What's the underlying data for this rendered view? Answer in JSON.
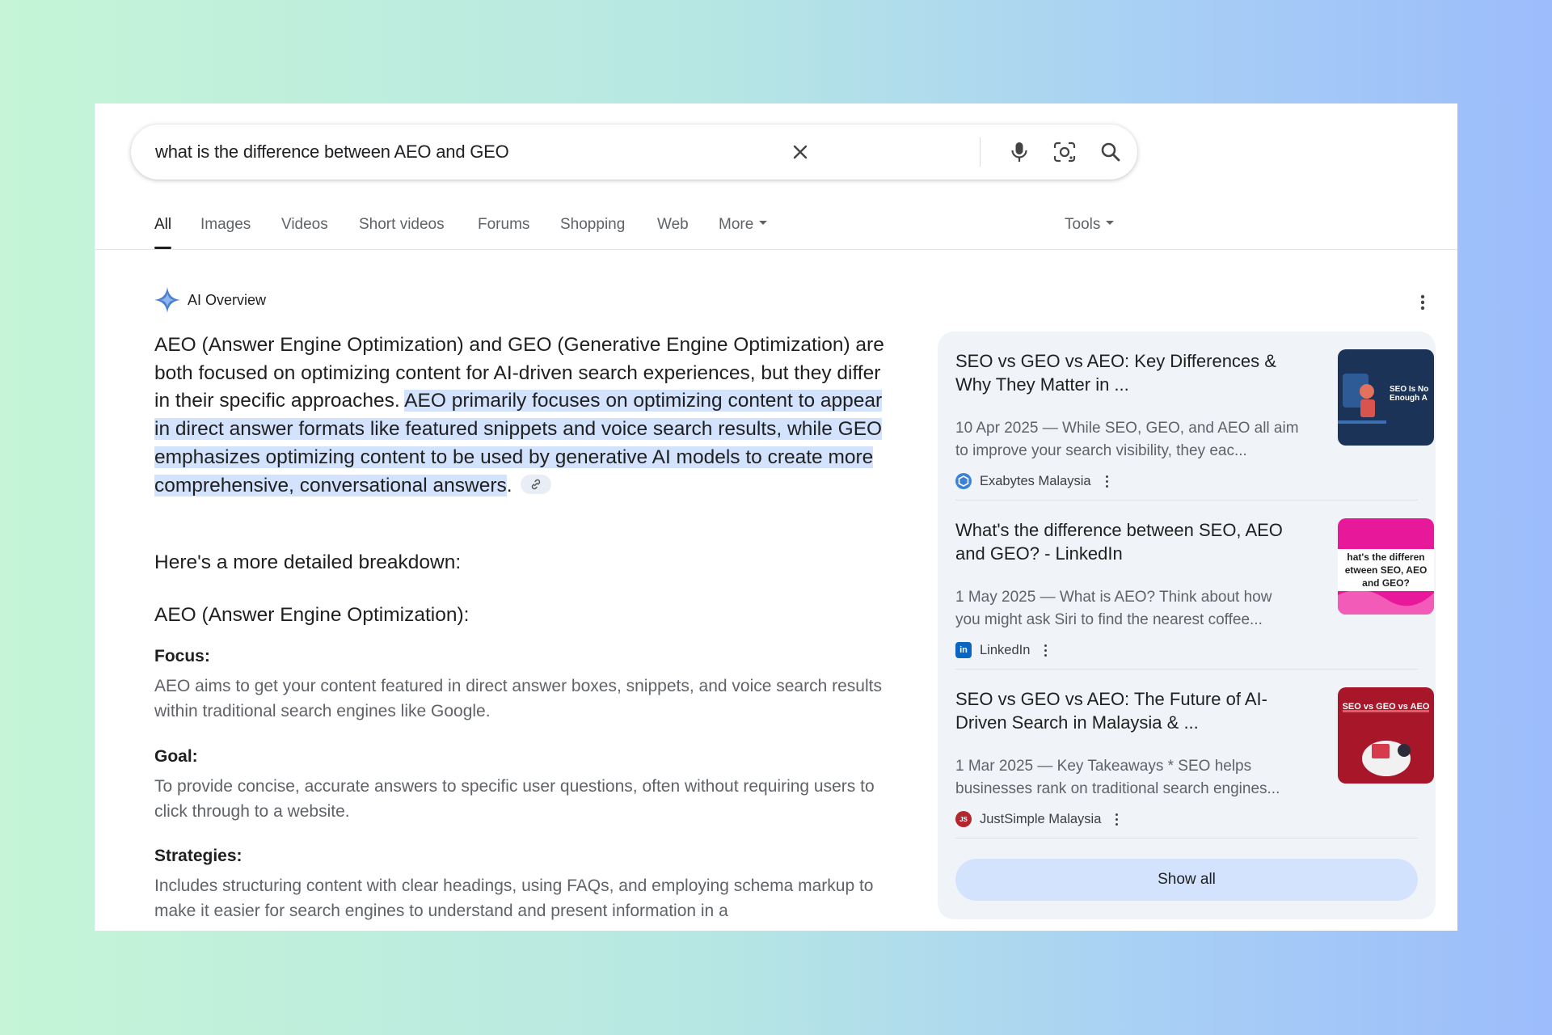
{
  "search": {
    "query": "what is the difference between AEO and GEO"
  },
  "tabs": [
    {
      "label": "All"
    },
    {
      "label": "Images"
    },
    {
      "label": "Videos"
    },
    {
      "label": "Short videos"
    },
    {
      "label": "Forums"
    },
    {
      "label": "Shopping"
    },
    {
      "label": "Web"
    },
    {
      "label": "More"
    }
  ],
  "tools_label": "Tools",
  "ai_overview": {
    "title": "AI Overview",
    "intro": "AEO (Answer Engine Optimization) and GEO (Generative Engine Optimization) are both focused on optimizing content for AI-driven search experiences, but they differ in their specific approaches.",
    "highlight": "AEO primarily focuses on optimizing content to appear in direct answer formats like featured snippets and voice search results, while GEO emphasizes optimizing content to be used by generative AI models to create more comprehensive, conversational answers",
    "period": ".",
    "breakdown": "Here's a more detailed breakdown:",
    "section_title": "AEO (Answer Engine Optimization):",
    "items": [
      {
        "label": "Focus:",
        "text": "AEO aims to get your content featured in direct answer boxes, snippets, and voice search results within traditional search engines like Google."
      },
      {
        "label": "Goal:",
        "text": "To provide concise, accurate answers to specific user questions, often without requiring users to click through to a website."
      },
      {
        "label": "Strategies:",
        "text": "Includes structuring content with clear headings, using FAQs, and employing schema markup to make it easier for search engines to understand and present information in a"
      }
    ]
  },
  "sources": [
    {
      "title": "SEO vs GEO vs AEO: Key Differences & Why They Matter in ...",
      "snippet": "10 Apr 2025 — While SEO, GEO, and AEO all aim to improve your search visibility, they eac...",
      "source": "Exabytes Malaysia",
      "thumb_text": "SEO Is No Enough A"
    },
    {
      "title": "What's the difference between SEO, AEO and GEO? - LinkedIn",
      "snippet": "1 May 2025 — What is AEO? Think about how you might ask Siri to find the nearest coffee...",
      "source": "LinkedIn",
      "thumb_text": "hat's the differen etween SEO, AEO and GEO?"
    },
    {
      "title": "SEO vs GEO vs AEO: The Future of AI-Driven Search in Malaysia & ...",
      "snippet": "1 Mar 2025 — Key Takeaways * SEO helps businesses rank on traditional search engines...",
      "source": "JustSimple Malaysia",
      "thumb_text": "SEO vs GEO vs AEO"
    }
  ],
  "show_all_label": "Show all",
  "colors": {
    "highlight": "#d3e3fd",
    "panel": "#f0f4f9",
    "muted_text": "#5f6368"
  }
}
